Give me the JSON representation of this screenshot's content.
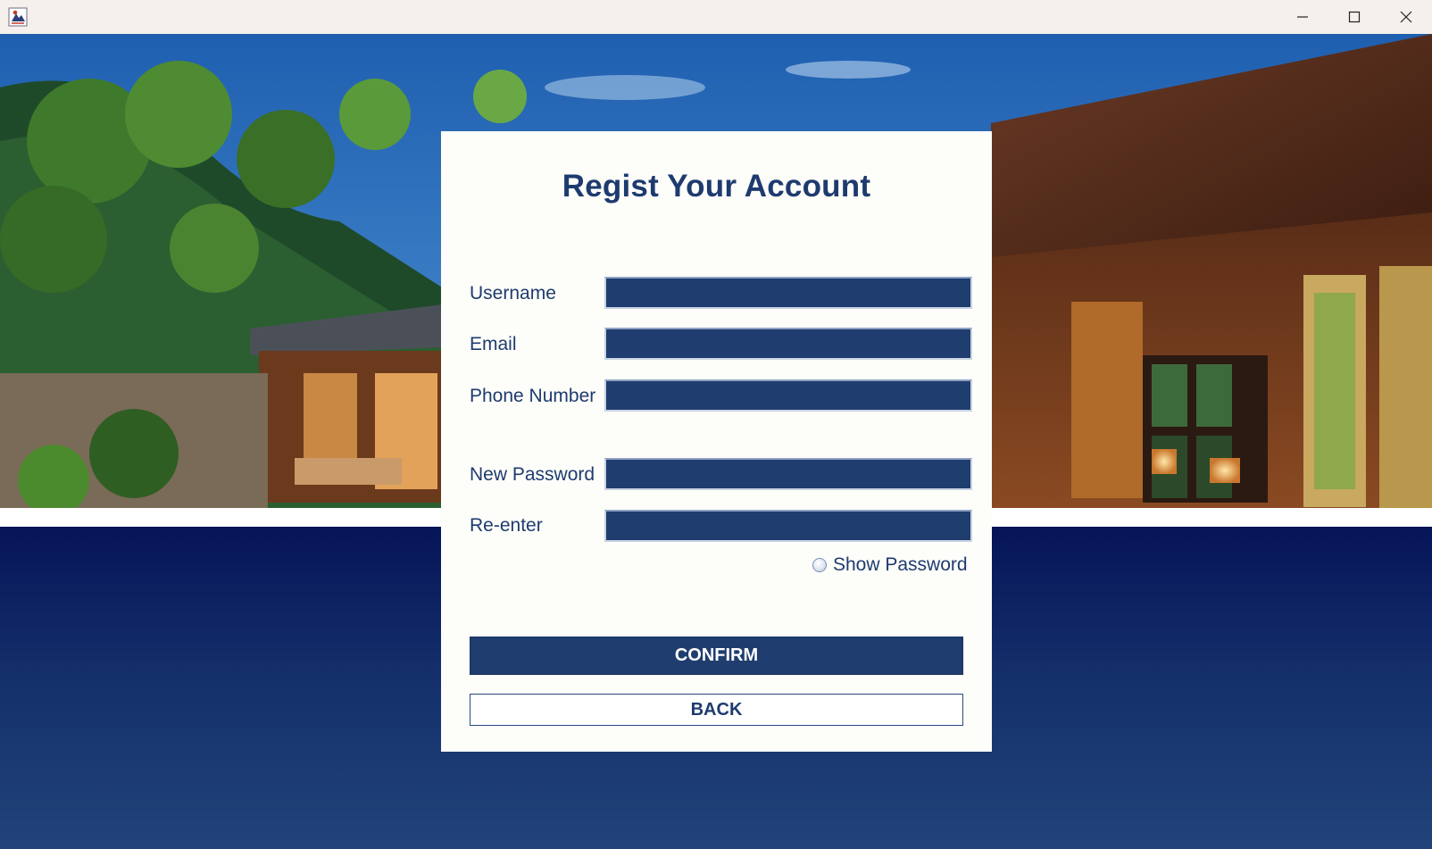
{
  "window": {
    "minimize_icon": "minimize-icon",
    "maximize_icon": "maximize-icon",
    "close_icon": "close-icon",
    "app_icon": "java-app-icon"
  },
  "form": {
    "title": "Regist Your Account",
    "fields": {
      "username": {
        "label": "Username",
        "value": ""
      },
      "email": {
        "label": "Email",
        "value": ""
      },
      "phone": {
        "label": "Phone Number",
        "value": ""
      },
      "new_password": {
        "label": "New Password",
        "value": ""
      },
      "reenter": {
        "label": "Re-enter",
        "value": ""
      }
    },
    "show_password": {
      "label": "Show Password",
      "checked": false
    },
    "confirm_label": "CONFIRM",
    "back_label": "BACK"
  },
  "colors": {
    "accent": "#1f3d6f",
    "title_text": "#1e3b6f",
    "card_bg": "#fdfdf9",
    "bottom_gradient_top": "#061458",
    "bottom_gradient_bottom": "#21437a"
  }
}
